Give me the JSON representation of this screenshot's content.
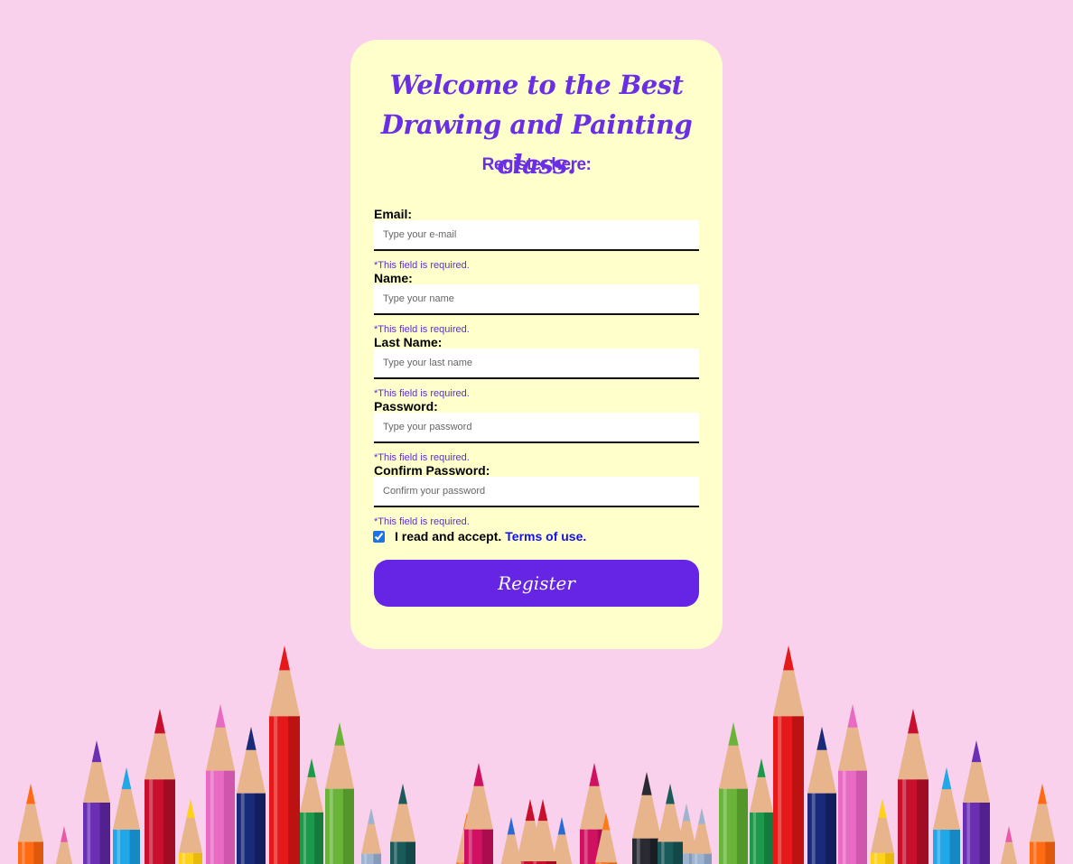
{
  "header": {
    "title": "Welcome to the Best Drawing and Painting class.",
    "subtitle": "Register here:"
  },
  "form": {
    "fields": [
      {
        "label": "Email:",
        "placeholder": "Type your e-mail",
        "error": "*This field is required."
      },
      {
        "label": "Name:",
        "placeholder": "Type your name",
        "error": "*This field is required."
      },
      {
        "label": "Last Name:",
        "placeholder": "Type your last name",
        "error": "*This field is required."
      },
      {
        "label": "Password:",
        "placeholder": "Type your password",
        "error": "*This field is required."
      },
      {
        "label": "Confirm Password:",
        "placeholder": "Confirm your password",
        "error": "*This field is required."
      }
    ],
    "terms": {
      "checked": true,
      "text": "I read and accept.",
      "link": "Terms of use."
    },
    "submit_label": "Register"
  },
  "colors": {
    "page_background": "#f9d1ec",
    "card_background": "#ffffcc",
    "accent": "#6624e4",
    "link": "#1111ee"
  }
}
